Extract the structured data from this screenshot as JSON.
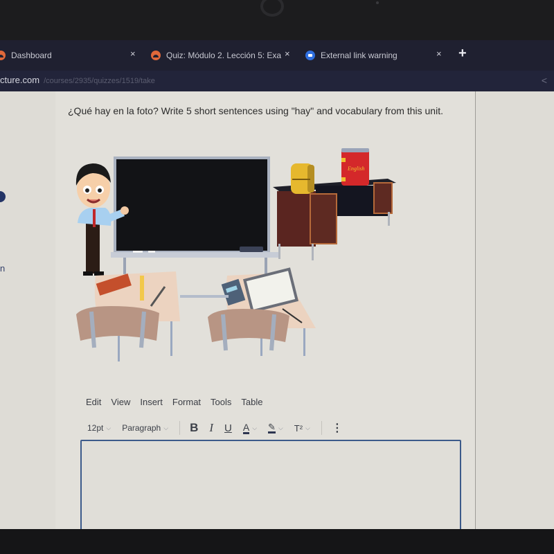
{
  "browser": {
    "tabs": [
      {
        "label": "Dashboard",
        "icon": "canvas-icon",
        "closable": true
      },
      {
        "label": "Quiz: Módulo 2. Lección 5: Exa",
        "icon": "canvas-icon",
        "closable": true
      },
      {
        "label": "External link warning",
        "icon": "video-meeting-icon",
        "closable": true
      }
    ],
    "close_glyph": "×",
    "new_tab_glyph": "+",
    "url_domain": "cture.com",
    "url_path": "/courses/2935/quizzes/1519/take",
    "share_glyph": "<"
  },
  "sidebar": {
    "partial_letter": "n"
  },
  "quiz": {
    "question_text": "¿Qué hay en la foto? Write 5 short sentences using \"hay\" and vocabulary from this unit.",
    "image_description": "Cartoon classroom: a waving teacher beside a blackboard, a teacher's desk with a yellow backpack and a red English dictionary, two student desks with a book, pencil, pen, calculator and binder.",
    "dictionary_label": "English"
  },
  "editor": {
    "menu": [
      "Edit",
      "View",
      "Insert",
      "Format",
      "Tools",
      "Table"
    ],
    "font_size": "12pt",
    "block_format": "Paragraph",
    "bold": "B",
    "italic": "I",
    "underline": "U",
    "font_color": "A",
    "highlight": "✎",
    "superscript": "T²",
    "more": "⋮",
    "chevron": "⌵",
    "content": ""
  }
}
